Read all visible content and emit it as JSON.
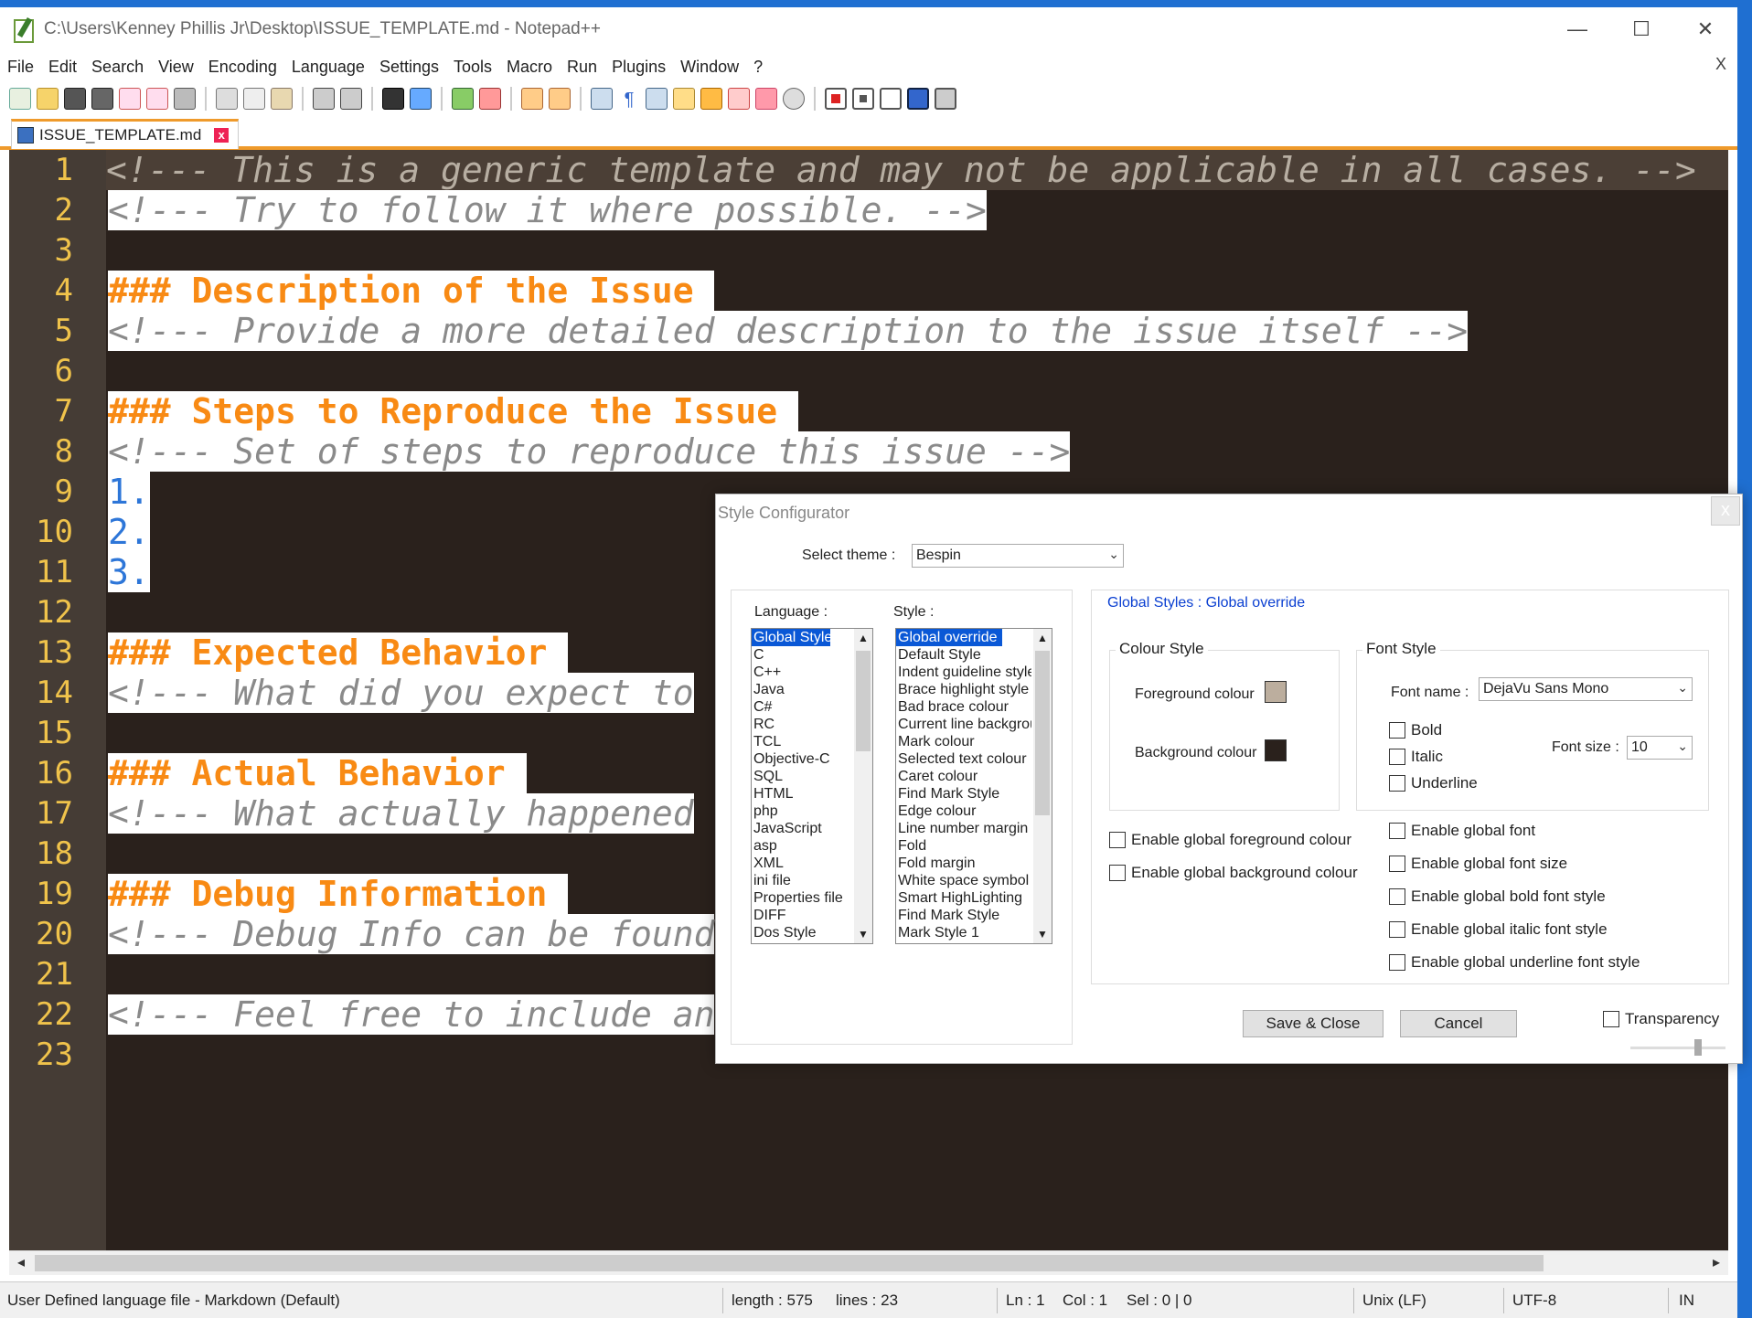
{
  "window": {
    "title": "C:\\Users\\Kenney Phillis Jr\\Desktop\\ISSUE_TEMPLATE.md - Notepad++",
    "minimize": "—",
    "maximize": "☐",
    "close": "✕"
  },
  "menu": {
    "items": [
      "File",
      "Edit",
      "Search",
      "View",
      "Encoding",
      "Language",
      "Settings",
      "Tools",
      "Macro",
      "Run",
      "Plugins",
      "Window",
      "?"
    ],
    "close_label": "X"
  },
  "tab": {
    "label": "ISSUE_TEMPLATE.md",
    "close_glyph": "x"
  },
  "editor": {
    "lines": [
      {
        "n": "1",
        "tokens": [
          {
            "t": "<!--- This is a generic template and may not be applicable in all cases. -->",
            "k": "comment cur"
          }
        ]
      },
      {
        "n": "2",
        "tokens": [
          {
            "t": "<!--- Try to follow it where possible. -->",
            "k": "comment"
          }
        ]
      },
      {
        "n": "3",
        "tokens": []
      },
      {
        "n": "4",
        "tokens": [
          {
            "t": "### Description of the Issue ",
            "k": "heading"
          }
        ]
      },
      {
        "n": "5",
        "tokens": [
          {
            "t": "<!--- Provide a more detailed description to the issue itself -->",
            "k": "comment"
          }
        ]
      },
      {
        "n": "6",
        "tokens": []
      },
      {
        "n": "7",
        "tokens": [
          {
            "t": "### Steps to Reproduce the Issue ",
            "k": "heading"
          }
        ]
      },
      {
        "n": "8",
        "tokens": [
          {
            "t": "<!--- Set of steps to reproduce this issue -->",
            "k": "comment"
          }
        ]
      },
      {
        "n": "9",
        "tokens": [
          {
            "t": "1.",
            "k": "list"
          }
        ]
      },
      {
        "n": "10",
        "tokens": [
          {
            "t": "2.",
            "k": "list"
          }
        ]
      },
      {
        "n": "11",
        "tokens": [
          {
            "t": "3.",
            "k": "list"
          }
        ]
      },
      {
        "n": "12",
        "tokens": []
      },
      {
        "n": "13",
        "tokens": [
          {
            "t": "### Expected Behavior ",
            "k": "heading"
          }
        ]
      },
      {
        "n": "14",
        "tokens": [
          {
            "t": "<!--- What did you expect to",
            "k": "comment"
          }
        ]
      },
      {
        "n": "15",
        "tokens": []
      },
      {
        "n": "16",
        "tokens": [
          {
            "t": "### Actual Behavior ",
            "k": "heading"
          }
        ]
      },
      {
        "n": "17",
        "tokens": [
          {
            "t": "<!--- What actually happened",
            "k": "comment"
          }
        ]
      },
      {
        "n": "18",
        "tokens": []
      },
      {
        "n": "19",
        "tokens": [
          {
            "t": "### Debug Information ",
            "k": "heading"
          }
        ]
      },
      {
        "n": "20",
        "tokens": [
          {
            "t": "<!--- Debug Info can be found",
            "k": "comment"
          }
        ]
      },
      {
        "n": "21",
        "tokens": []
      },
      {
        "n": "22",
        "tokens": [
          {
            "t": "<!--- Feel free to include an",
            "k": "comment"
          }
        ]
      },
      {
        "n": "23",
        "tokens": []
      }
    ]
  },
  "status": {
    "file_type": "User Defined language file - Markdown (Default)",
    "length": "length : 575",
    "lines": "lines : 23",
    "ln": "Ln : 1",
    "col": "Col : 1",
    "sel": "Sel : 0 | 0",
    "eol": "Unix (LF)",
    "encoding": "UTF-8",
    "mode": "IN"
  },
  "dialog": {
    "title": "Style Configurator",
    "close_glyph": "x",
    "select_theme_label": "Select theme :",
    "theme_value": "Bespin",
    "language_label": "Language :",
    "style_label": "Style :",
    "languages": [
      "Global Styles",
      "C",
      "C++",
      "Java",
      "C#",
      "RC",
      "TCL",
      "Objective-C",
      "SQL",
      "HTML",
      "php",
      "JavaScript",
      "asp",
      "XML",
      "ini file",
      "Properties file",
      "DIFF",
      "Dos Style"
    ],
    "styles": [
      "Global override",
      "Default Style",
      "Indent guideline style",
      "Brace highlight style",
      "Bad brace colour",
      "Current line background colour",
      "Mark colour",
      "Selected text colour",
      "Caret colour",
      "Find Mark Style",
      "Edge colour",
      "Line number margin",
      "Fold",
      "Fold margin",
      "White space symbol",
      "Smart HighLighting",
      "Find Mark Style",
      "Mark Style 1"
    ],
    "heading": "Global Styles : Global override",
    "colour_style_title": "Colour Style",
    "foreground_label": "Foreground colour",
    "background_label": "Background colour",
    "foreground_color": "#bcae9e",
    "background_color": "#2a211c",
    "font_style_title": "Font Style",
    "font_name_label": "Font name :",
    "font_name_value": "DejaVu Sans Mono",
    "bold_label": "Bold",
    "italic_label": "Italic",
    "underline_label": "Underline",
    "font_size_label": "Font size :",
    "font_size_value": "10",
    "enable_fg": "Enable global foreground colour",
    "enable_bg": "Enable global background colour",
    "enable_font": "Enable global font",
    "enable_font_size": "Enable global font size",
    "enable_bold": "Enable global bold font style",
    "enable_italic": "Enable global italic font style",
    "enable_underline": "Enable global underline font style",
    "save_close": "Save & Close",
    "cancel": "Cancel",
    "transparency": "Transparency"
  }
}
